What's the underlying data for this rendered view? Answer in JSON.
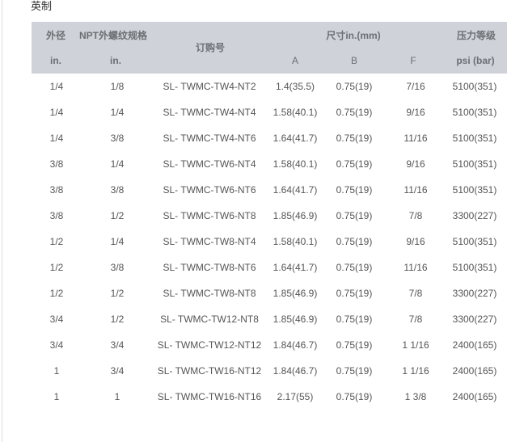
{
  "caption": "英制",
  "header": {
    "od_label": "外径",
    "od_unit": "in.",
    "npt_label": "NPT外螺纹规格",
    "npt_unit": "in.",
    "order_label": "订购号",
    "dim_label": "尺寸in.(mm)",
    "dim_a": "A",
    "dim_b": "B",
    "dim_f": "F",
    "pressure_label": "压力等级",
    "pressure_unit": "psi (bar)"
  },
  "rows": [
    {
      "od": "1/4",
      "npt": "1/8",
      "order": "SL- TWMC-TW4-NT2",
      "a": "1.4(35.5)",
      "b": "0.75(19)",
      "f": "7/16",
      "p": "5100(351)"
    },
    {
      "od": "1/4",
      "npt": "1/4",
      "order": "SL- TWMC-TW4-NT4",
      "a": "1.58(40.1)",
      "b": "0.75(19)",
      "f": "9/16",
      "p": "5100(351)"
    },
    {
      "od": "1/4",
      "npt": "3/8",
      "order": "SL- TWMC-TW4-NT6",
      "a": "1.64(41.7)",
      "b": "0.75(19)",
      "f": "11/16",
      "p": "5100(351)"
    },
    {
      "od": "3/8",
      "npt": "1/4",
      "order": "SL- TWMC-TW6-NT4",
      "a": "1.58(40.1)",
      "b": "0.75(19)",
      "f": "9/16",
      "p": "5100(351)"
    },
    {
      "od": "3/8",
      "npt": "3/8",
      "order": "SL- TWMC-TW6-NT6",
      "a": "1.64(41.7)",
      "b": "0.75(19)",
      "f": "11/16",
      "p": "5100(351)"
    },
    {
      "od": "3/8",
      "npt": "1/2",
      "order": "SL- TWMC-TW6-NT8",
      "a": "1.85(46.9)",
      "b": "0.75(19)",
      "f": "7/8",
      "p": "3300(227)"
    },
    {
      "od": "1/2",
      "npt": "1/4",
      "order": "SL- TWMC-TW8-NT4",
      "a": "1.58(40.1)",
      "b": "0.75(19)",
      "f": "9/16",
      "p": "5100(351)"
    },
    {
      "od": "1/2",
      "npt": "3/8",
      "order": "SL- TWMC-TW8-NT6",
      "a": "1.64(41.7)",
      "b": "0.75(19)",
      "f": "11/16",
      "p": "5100(351)"
    },
    {
      "od": "1/2",
      "npt": "1/2",
      "order": "SL- TWMC-TW8-NT8",
      "a": "1.85(46.9)",
      "b": "0.75(19)",
      "f": "7/8",
      "p": "3300(227)"
    },
    {
      "od": "3/4",
      "npt": "1/2",
      "order": "SL- TWMC-TW12-NT8",
      "a": "1.85(46.9)",
      "b": "0.75(19)",
      "f": "7/8",
      "p": "3300(227)"
    },
    {
      "od": "3/4",
      "npt": "3/4",
      "order": "SL- TWMC-TW12-NT12",
      "a": "1.84(46.7)",
      "b": "0.75(19)",
      "f": "1  1/16",
      "p": "2400(165)"
    },
    {
      "od": "1",
      "npt": "3/4",
      "order": "SL- TWMC-TW16-NT12",
      "a": "1.84(46.7)",
      "b": "0.75(19)",
      "f": "1  1/16",
      "p": "2400(165)"
    },
    {
      "od": "1",
      "npt": "1",
      "order": "SL- TWMC-TW16-NT16",
      "a": "2.17(55)",
      "b": "0.75(19)",
      "f": "1  3/8",
      "p": "2400(165)"
    }
  ]
}
